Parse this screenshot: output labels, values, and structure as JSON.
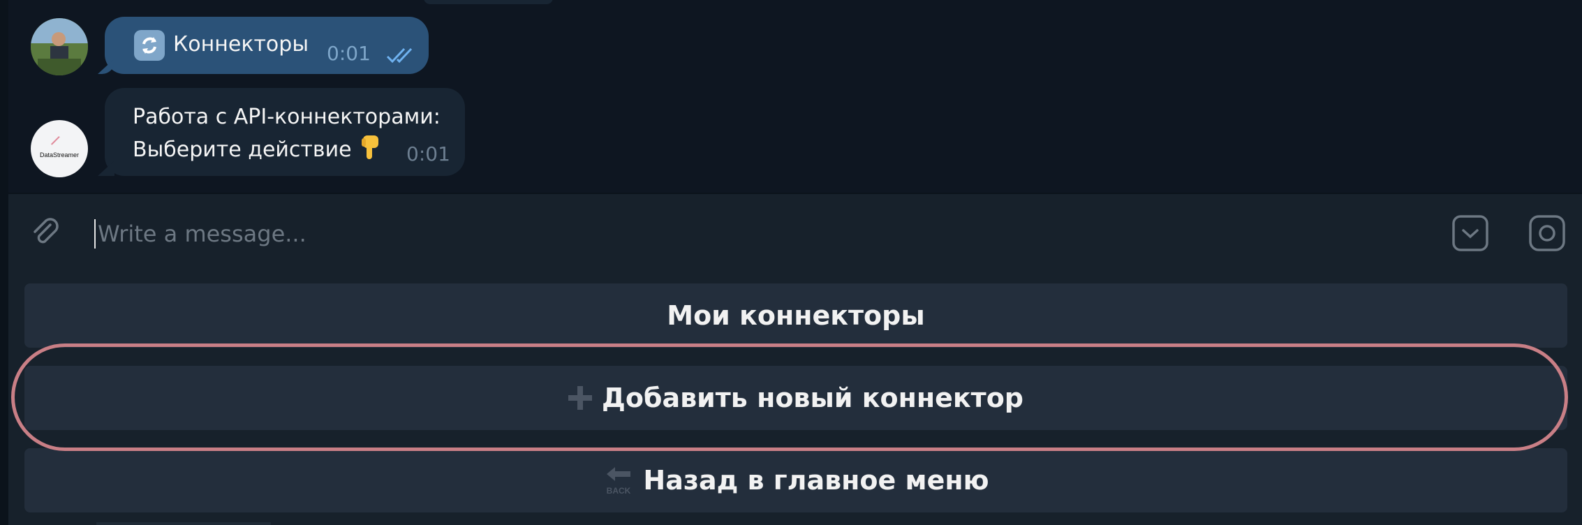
{
  "messages": {
    "outgoing": {
      "text": "Коннекторы",
      "time": "0:01"
    },
    "incoming": {
      "line1": "Работа с API-коннекторами:",
      "line2": "Выберите действие",
      "time": "0:01",
      "bot_logo_text": "DataStreamer"
    }
  },
  "composer": {
    "placeholder": "Write a message..."
  },
  "keyboard": {
    "buttons": [
      {
        "label": "Мои коннекторы"
      },
      {
        "label": "Добавить новый коннектор"
      },
      {
        "label": "Назад в главное меню"
      }
    ],
    "back_icon_text": "BACK"
  },
  "colors": {
    "background": "#0e1621",
    "outgoing_bubble": "#2b5278",
    "incoming_bubble": "#182533",
    "button": "#232e3c",
    "highlight": "#c97f86"
  },
  "icons": [
    "double-check-icon",
    "refresh-icon",
    "pointing-down-icon",
    "paperclip-icon",
    "sticker-icon",
    "camera-icon",
    "plus-icon",
    "back-arrow-icon"
  ]
}
